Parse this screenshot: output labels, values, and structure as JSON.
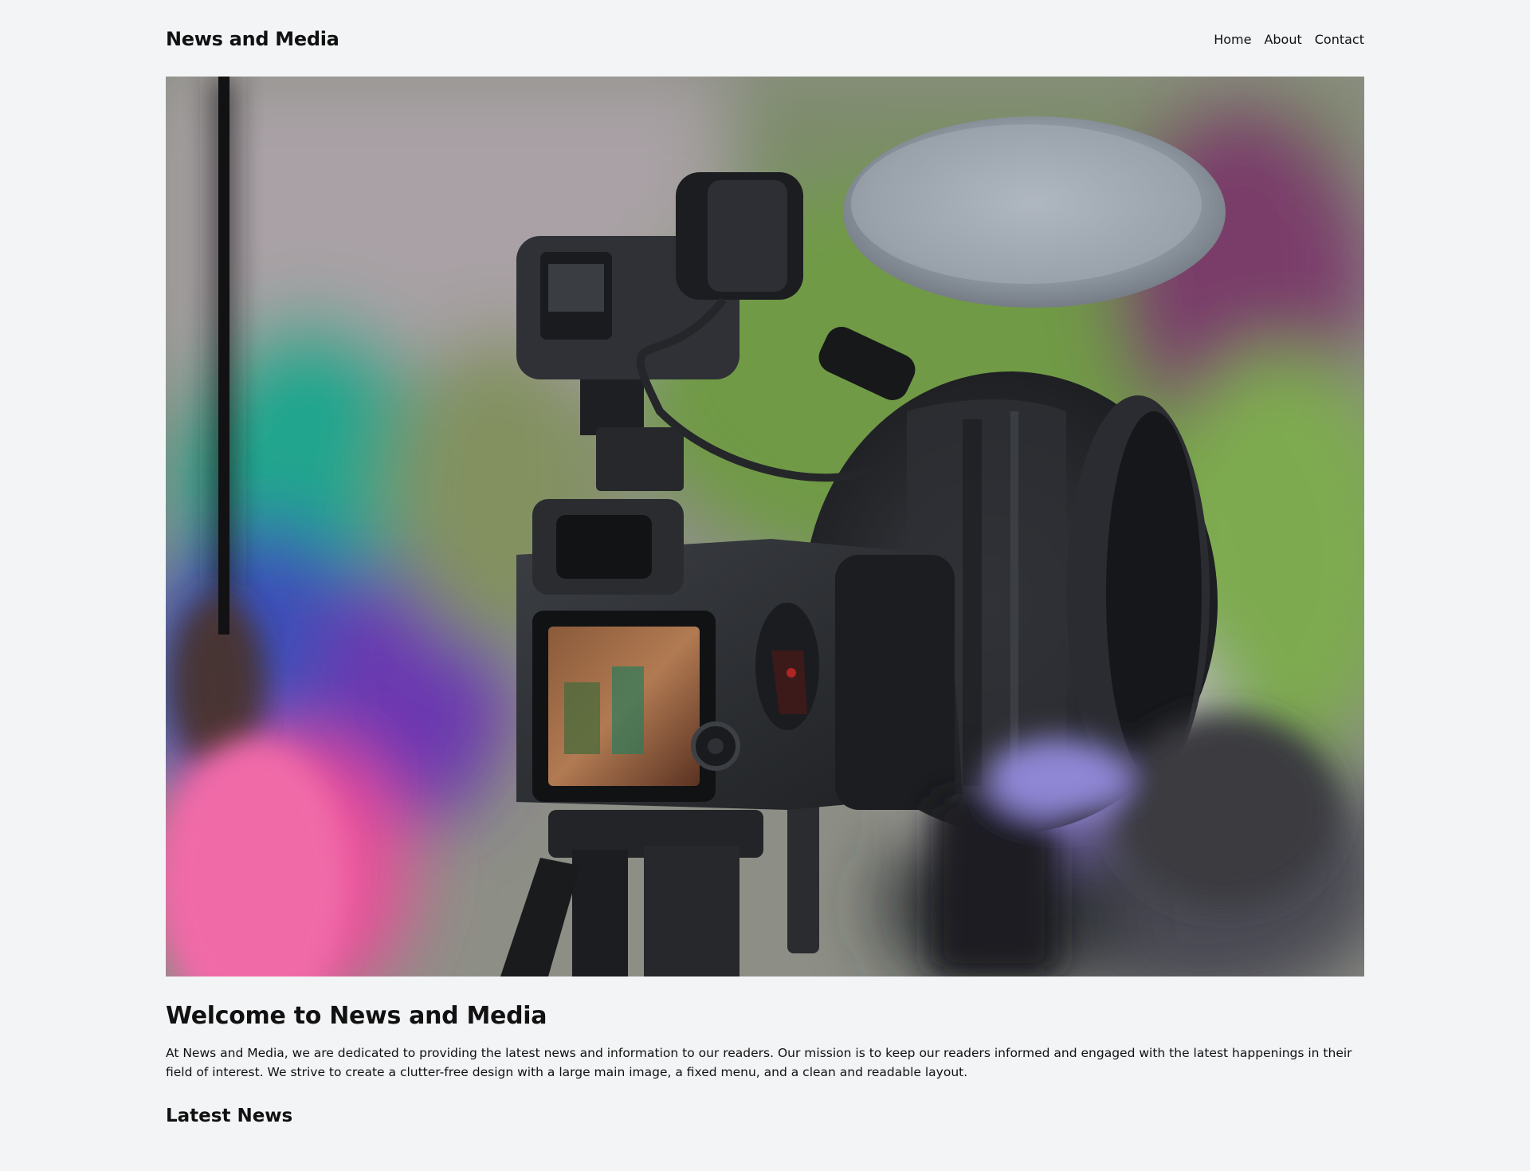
{
  "site": {
    "title": "News and Media"
  },
  "nav": {
    "items": [
      {
        "label": "Home"
      },
      {
        "label": "About"
      },
      {
        "label": "Contact"
      }
    ]
  },
  "hero": {
    "description_icon": "camera-image"
  },
  "main": {
    "heading": "Welcome to News and Media",
    "intro": "At News and Media, we are dedicated to providing the latest news and information to our readers. Our mission is to keep our readers informed and engaged with the latest happenings in their field of interest. We strive to create a clutter-free design with a large main image, a fixed menu, and a clean and readable layout.",
    "latest_heading": "Latest News"
  },
  "colors": {
    "background": "#f3f4f6",
    "text": "#111111"
  }
}
